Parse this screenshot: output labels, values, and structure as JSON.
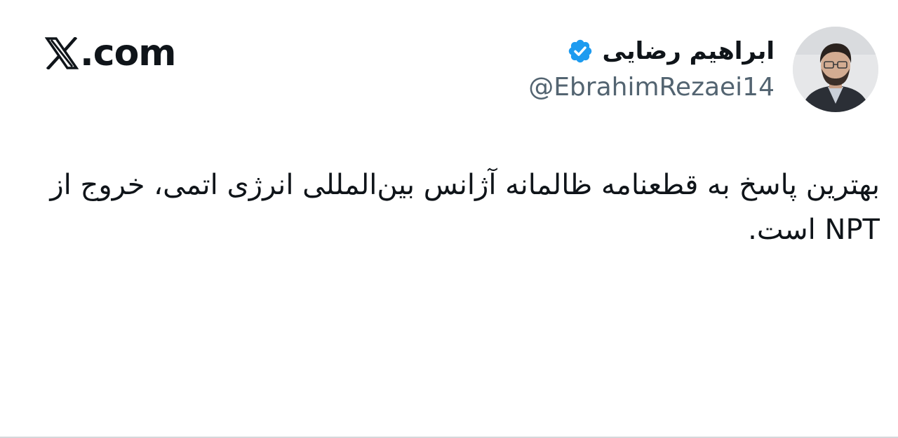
{
  "brand": {
    "label": ".com",
    "icon": "x-logo-icon"
  },
  "author": {
    "display_name": "ابراهیم رضایی",
    "handle": "@EbrahimRezaei14",
    "verified": true,
    "verified_color": "#1d9bf0"
  },
  "tweet": {
    "text": "بهترین پاسخ به قطعنامه ظالمانه آژانس بین‌المللی انرژی اتمی، خروج از NPT است."
  },
  "colors": {
    "text_primary": "#0f1419",
    "text_secondary": "#536471",
    "background": "#ffffff"
  }
}
